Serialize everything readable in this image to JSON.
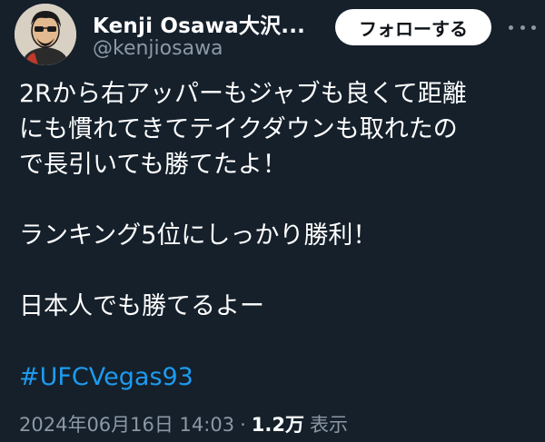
{
  "user": {
    "display_name": "Kenji Osawa大沢...",
    "handle": "@kenjiosawa",
    "follow_label": "フォローする"
  },
  "tweet": {
    "lines": [
      "2Rから右アッパーもジャブも良くて距離",
      "にも慣れてきてテイクダウンも取れたの",
      "で長引いても勝てたよ！",
      "",
      "ランキング5位にしっかり勝利！",
      "",
      "日本人でも勝てるよー",
      "",
      "#UFCVegas93"
    ],
    "hashtag": "#UFCVegas93"
  },
  "meta": {
    "timestamp": "2024年06月16日 14:03",
    "separator": "·",
    "views_count": "1.2万",
    "views_label": "表示"
  },
  "colors": {
    "background": "#15202b",
    "text": "#ffffff",
    "secondary_text": "#8b98a5",
    "link": "#1d9bf0",
    "follow_button_bg": "#ffffff"
  },
  "icons": {
    "more": "more-horizontal-icon"
  }
}
